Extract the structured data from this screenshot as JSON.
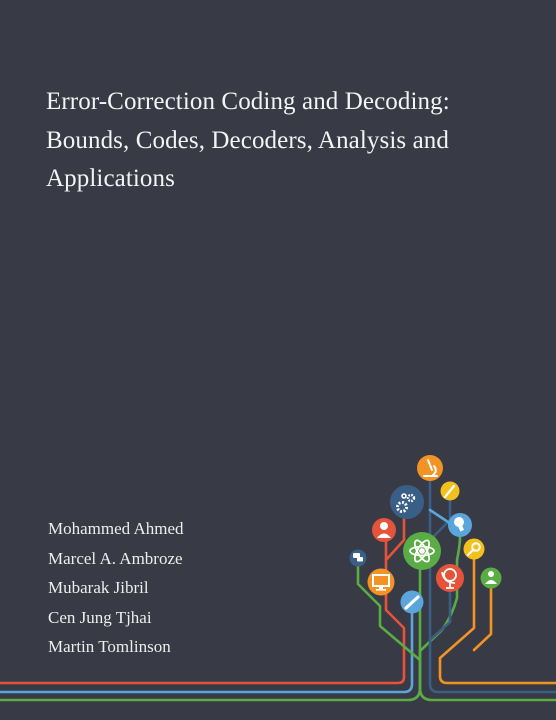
{
  "book": {
    "title_lines": [
      "Error-Correction Coding and Decoding:",
      "Bounds, Codes, Decoders, Analysis and",
      "Applications"
    ],
    "authors": [
      "Mohammed Ahmed",
      "Marcel A. Ambroze",
      "Mubarak Jibril",
      "Cen Jung Tjhai",
      "Martin Tomlinson"
    ]
  },
  "illustration": {
    "description": "knowledge tree with icon nodes",
    "colors": {
      "background": "#383a45",
      "red": "#e5533a",
      "orange": "#f39325",
      "yellow": "#f2c11e",
      "green": "#5aac44",
      "light_blue": "#5aa6dc",
      "dark_blue": "#3a5f86"
    },
    "nodes": [
      {
        "icon": "microscope-icon",
        "color": "orange"
      },
      {
        "icon": "brush-icon",
        "color": "yellow"
      },
      {
        "icon": "gears-icon",
        "color": "dark_blue"
      },
      {
        "icon": "person-icon",
        "color": "red"
      },
      {
        "icon": "lightbulb-icon",
        "color": "light_blue"
      },
      {
        "icon": "atom-icon",
        "color": "green"
      },
      {
        "icon": "chat-icon",
        "color": "dark_blue"
      },
      {
        "icon": "magnifier-icon",
        "color": "yellow"
      },
      {
        "icon": "monitor-icon",
        "color": "orange"
      },
      {
        "icon": "globe-icon",
        "color": "red"
      },
      {
        "icon": "people-icon",
        "color": "green"
      },
      {
        "icon": "pencil-icon",
        "color": "light_blue"
      }
    ]
  }
}
